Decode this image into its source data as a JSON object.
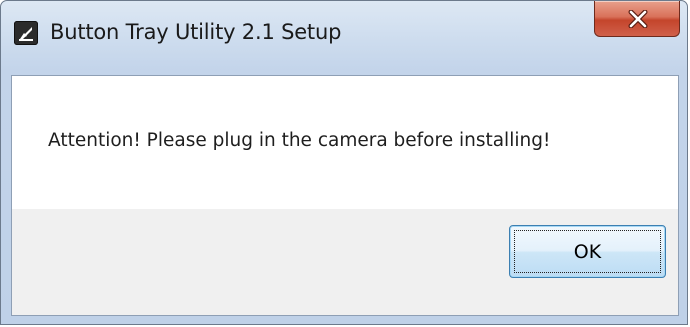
{
  "window": {
    "title": "Button Tray Utility 2.1 Setup",
    "icon": "app-logo-icon",
    "close_icon": "close-icon"
  },
  "dialog": {
    "message": "Attention! Please plug in the camera before installing!",
    "ok_label": "OK"
  },
  "colors": {
    "close_button": "#c94b33",
    "ok_border": "#3c7fb1",
    "frame": "#c3d4ea"
  }
}
